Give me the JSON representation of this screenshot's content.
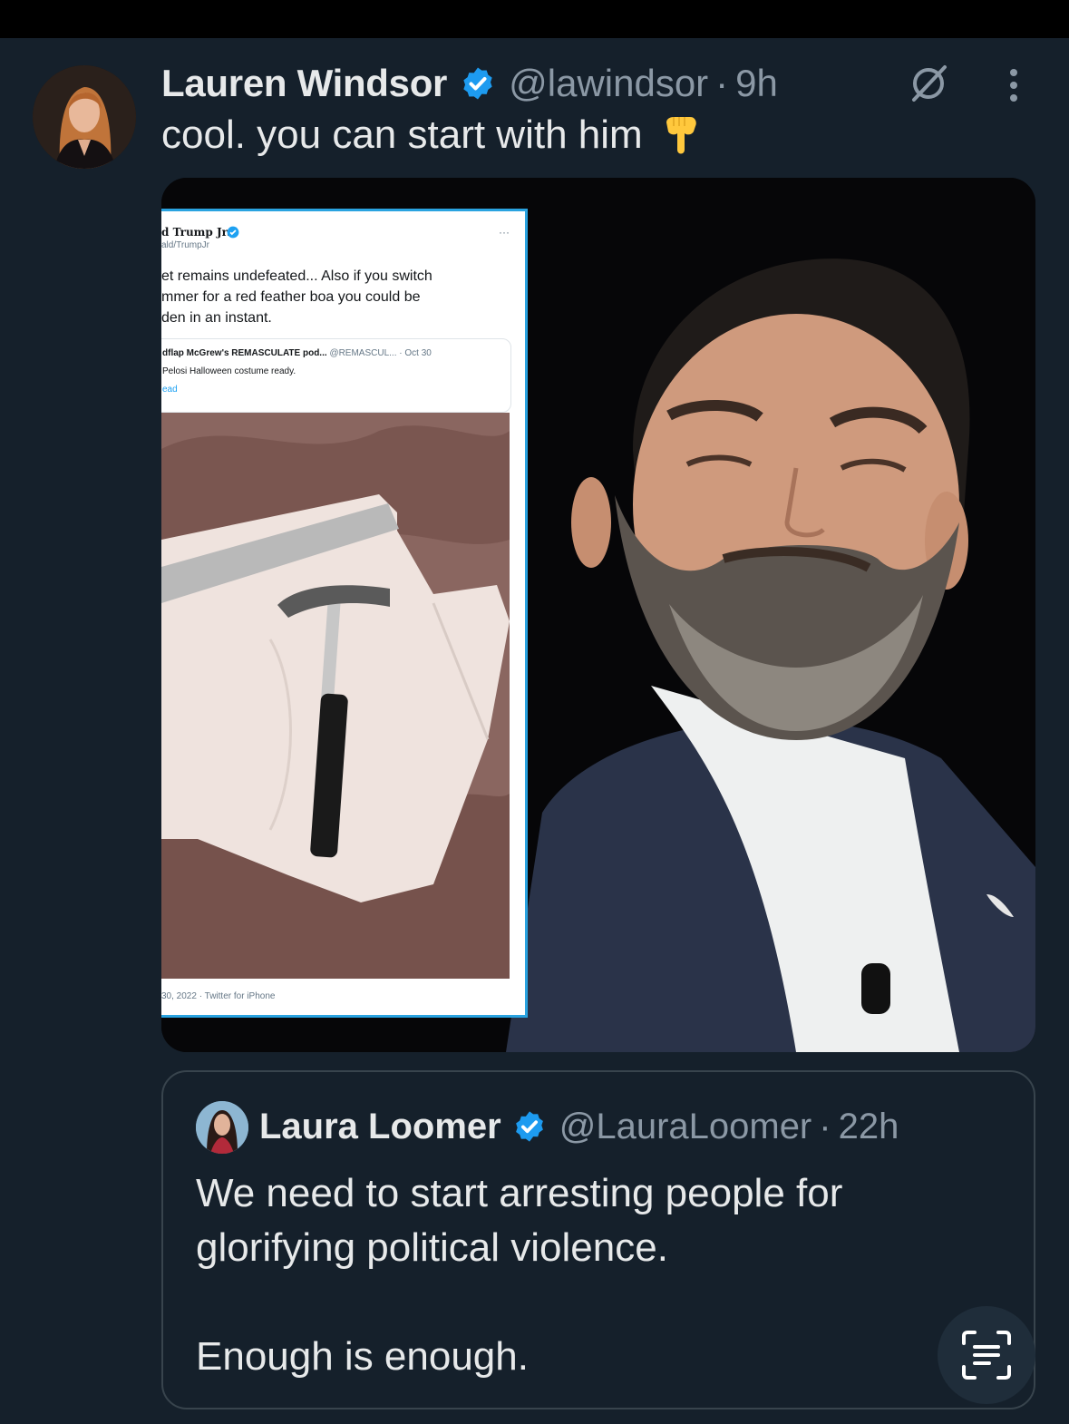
{
  "tweet": {
    "author_name": "Lauren Windsor",
    "handle": "@lawindsor",
    "separator": "·",
    "time": "9h",
    "text": "cool. you can start with him",
    "emoji": "backhand-index-pointing-down"
  },
  "media": {
    "inset_screenshot": {
      "name": "d Trump Jr.",
      "handle": "ald/TrumpJr",
      "dots": "···",
      "lines": [
        "et remains undefeated... Also if you switch",
        "mmer for a red feather boa you could be",
        "den in an instant."
      ],
      "card_title": "dflap McGrew's REMASCULATE pod...",
      "card_handle": "@REMASCUL...",
      "card_date": "· Oct 30",
      "card_sub": "Pelosi Halloween costume ready.",
      "card_link": "ead",
      "footer": "30, 2022 · Twitter for iPhone"
    }
  },
  "quote": {
    "author_name": "Laura Loomer",
    "handle": "@LauraLoomer",
    "separator": "·",
    "time": "22h",
    "lines": [
      "We need to start arresting people for",
      "glorifying political violence.",
      "",
      "Enough is enough."
    ]
  },
  "colors": {
    "background": "#15202b",
    "verified_blue": "#1d9bf0",
    "secondary_text": "#8b98a5",
    "primary_text": "#e7e9ea",
    "border": "#38444d"
  }
}
